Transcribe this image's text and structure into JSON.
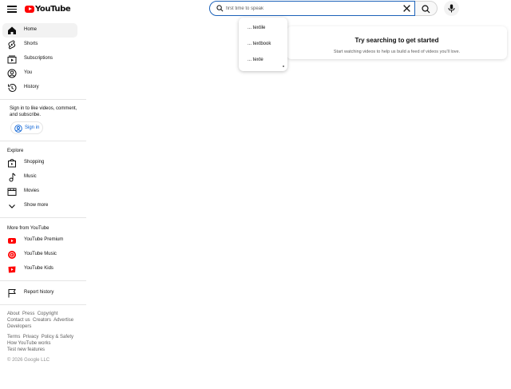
{
  "header": {
    "logo_text": "YouTube",
    "search_value": "first time to speak",
    "search_placeholder": "Search"
  },
  "suggestions": [
    "... textile",
    "... textbook",
    "... texte"
  ],
  "sidebar": {
    "primary": [
      {
        "label": "Home",
        "icon": "home-icon",
        "active": true
      },
      {
        "label": "Shorts",
        "icon": "shorts-icon"
      },
      {
        "label": "Subscriptions",
        "icon": "subscriptions-icon"
      },
      {
        "label": "You",
        "icon": "you-icon"
      },
      {
        "label": "History",
        "icon": "history-icon"
      }
    ],
    "signin_prompt": "Sign in to like videos, comment, and subscribe.",
    "signin_label": "Sign in",
    "explore_title": "Explore",
    "explore": [
      {
        "label": "Shopping",
        "icon": "shopping-bag-icon"
      },
      {
        "label": "Music",
        "icon": "music-note-icon"
      },
      {
        "label": "Movies",
        "icon": "movies-icon"
      },
      {
        "label": "Show more",
        "icon": "chevron-down-icon"
      }
    ],
    "more_title": "More from YouTube",
    "more": [
      {
        "label": "YouTube Premium",
        "icon": "youtube-premium-icon"
      },
      {
        "label": "YouTube Music",
        "icon": "youtube-music-icon"
      },
      {
        "label": "YouTube Kids",
        "icon": "youtube-kids-icon"
      }
    ],
    "report_history": "Report history",
    "footer_line1": [
      "About",
      "Press",
      "Copyright"
    ],
    "footer_line2": [
      "Contact us",
      "Creators",
      "Advertise"
    ],
    "footer_line3": [
      "Developers"
    ],
    "footer_line4": [
      "Terms",
      "Privacy",
      "Policy & Safety"
    ],
    "footer_line5": [
      "How YouTube works"
    ],
    "footer_line6": [
      "Test new features"
    ],
    "copyright": "© 2026 Google LLC"
  },
  "main": {
    "card_title": "Try searching to get started",
    "card_subtitle": "Start watching videos to help us build a feed of videos you'll love."
  },
  "colors": {
    "brand_red": "#ff0000",
    "link_blue": "#065fd4",
    "focus_blue": "#1c62b9"
  }
}
